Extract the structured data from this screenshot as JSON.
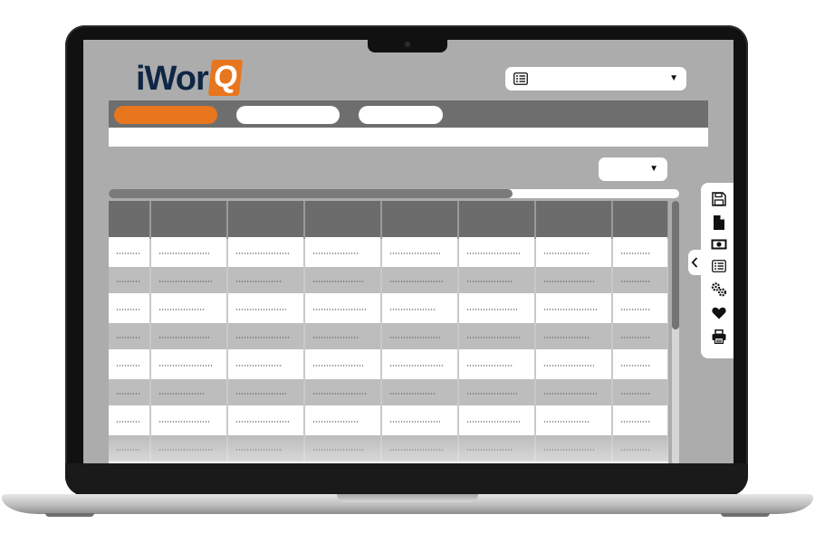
{
  "app": {
    "logo_text": "iWor",
    "logo_mark": "Q",
    "brand_color": "#e8761e",
    "navy_color": "#0f2645"
  },
  "top_select": {
    "icon": "list-icon",
    "value": ""
  },
  "tabs": [
    {
      "label": "",
      "active": true
    },
    {
      "label": "",
      "active": false
    },
    {
      "label": "",
      "active": false
    }
  ],
  "filter_select": {
    "value": ""
  },
  "table": {
    "columns": [
      "",
      "",
      "",
      "",
      "",
      "",
      "",
      ""
    ],
    "row_count": 8
  },
  "toolbar": {
    "items": [
      "save-icon",
      "document-icon",
      "cash-icon",
      "list-icon",
      "gears-icon",
      "heart-icon",
      "print-icon"
    ]
  },
  "side_toggle": {
    "icon": "chevron-left-icon"
  }
}
